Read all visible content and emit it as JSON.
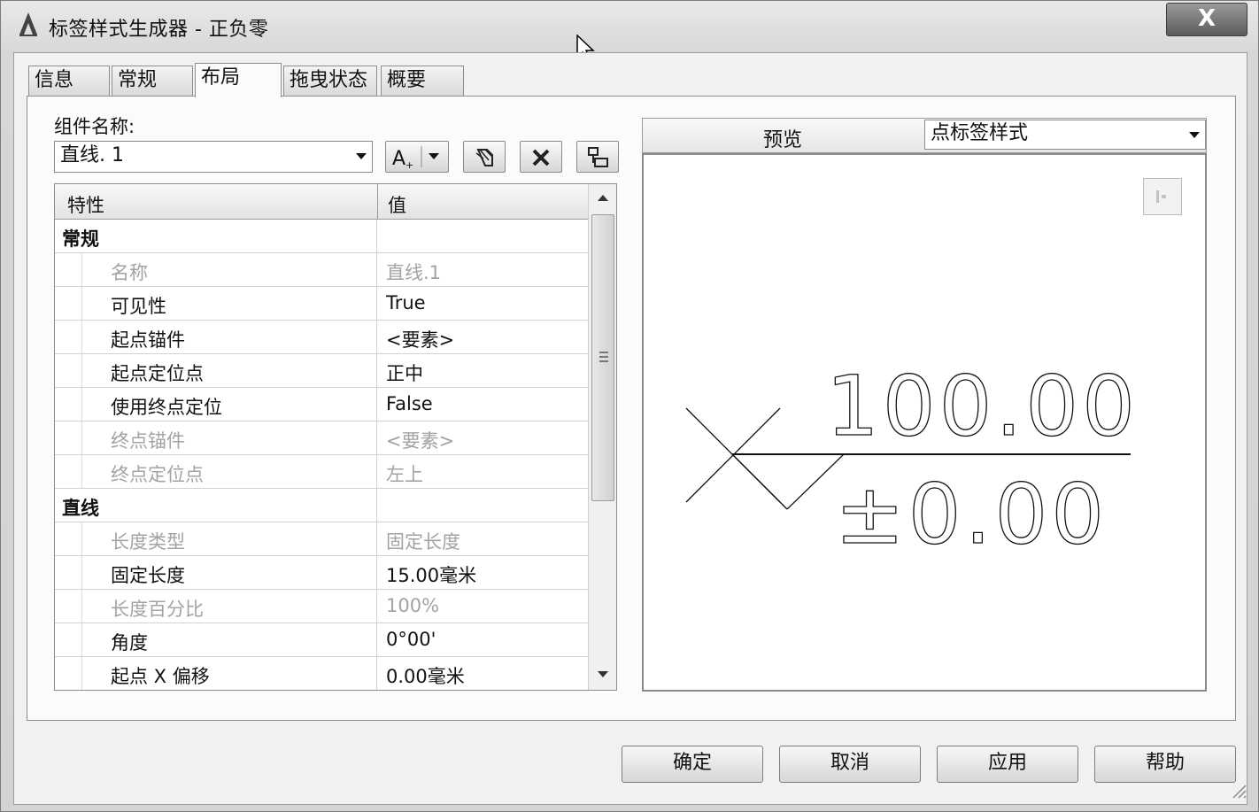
{
  "window": {
    "title": "标签样式生成器 - 正负零",
    "close_label": "X"
  },
  "tabs": [
    {
      "label": "信息",
      "active": false
    },
    {
      "label": "常规",
      "active": false
    },
    {
      "label": "布局",
      "active": true
    },
    {
      "label": "拖曳状态",
      "active": false
    },
    {
      "label": "概要",
      "active": false
    }
  ],
  "component": {
    "label": "组件名称:",
    "selected": "直线. 1"
  },
  "toolbar": {
    "text_component_icon": "A-plus-icon",
    "copy_icon": "copy-component-icon",
    "delete_icon": "delete-icon",
    "order_icon": "component-order-icon"
  },
  "grid": {
    "headers": {
      "property": "特性",
      "value": "值"
    },
    "rows": [
      {
        "type": "category",
        "name": "常规",
        "value": ""
      },
      {
        "type": "disabled",
        "name": "名称",
        "value": "直线.1"
      },
      {
        "type": "normal",
        "name": "可见性",
        "value": "True"
      },
      {
        "type": "normal",
        "name": "起点锚件",
        "value": "<要素>"
      },
      {
        "type": "normal",
        "name": "起点定位点",
        "value": "正中"
      },
      {
        "type": "normal",
        "name": "使用终点定位",
        "value": "False"
      },
      {
        "type": "disabled",
        "name": "终点锚件",
        "value": "<要素>"
      },
      {
        "type": "disabled",
        "name": "终点定位点",
        "value": "左上"
      },
      {
        "type": "category",
        "name": "直线",
        "value": ""
      },
      {
        "type": "disabled",
        "name": "长度类型",
        "value": "固定长度"
      },
      {
        "type": "normal",
        "name": "固定长度",
        "value": "15.00毫米"
      },
      {
        "type": "disabled",
        "name": "长度百分比",
        "value": "100%"
      },
      {
        "type": "normal",
        "name": "角度",
        "value": "0°00'"
      },
      {
        "type": "normal",
        "name": "起点 X 偏移",
        "value": "0.00毫米"
      }
    ]
  },
  "preview": {
    "label": "预览",
    "style_selected": "点标签样式",
    "top_value": "100.00",
    "bottom_value": "±0.00"
  },
  "buttons": {
    "ok": "确定",
    "cancel": "取消",
    "apply": "应用",
    "help": "帮助"
  }
}
